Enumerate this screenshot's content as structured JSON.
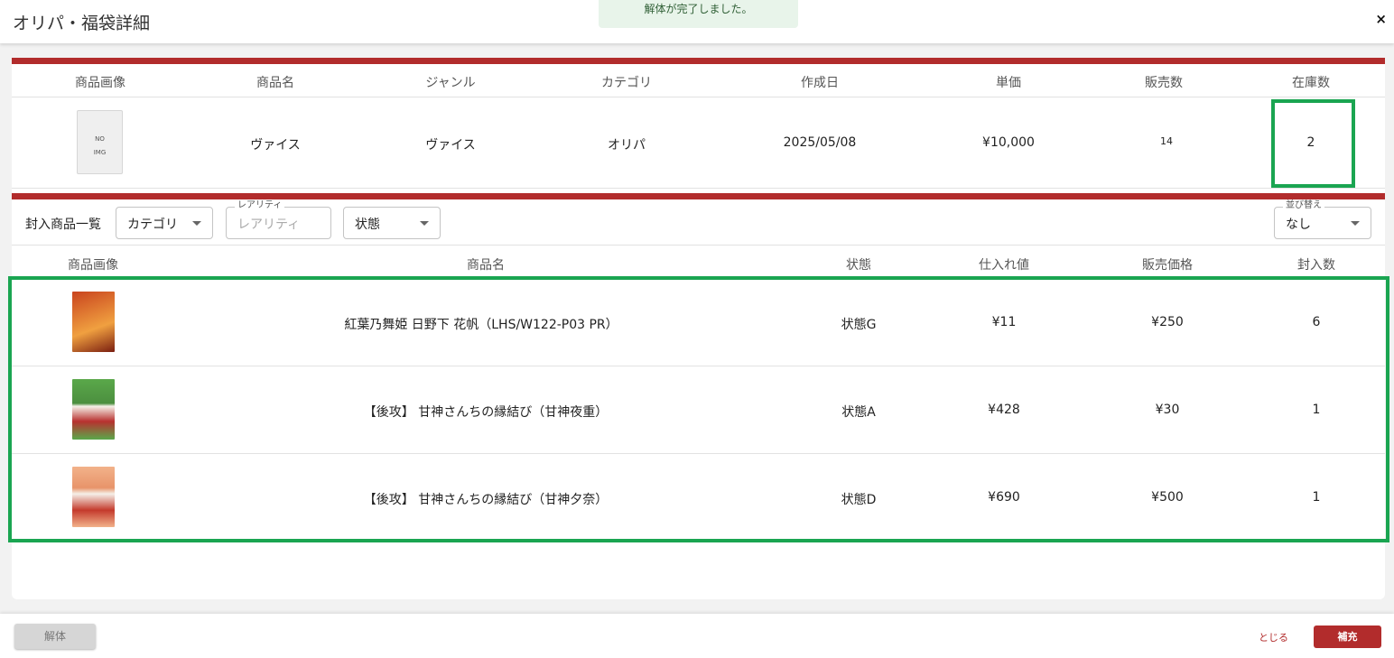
{
  "dialog": {
    "title": "オリパ・福袋詳細",
    "close": "×"
  },
  "toast": "解体が完了しました。",
  "product": {
    "headers": [
      "商品画像",
      "商品名",
      "ジャンル",
      "カテゴリ",
      "作成日",
      "単価",
      "販売数",
      "在庫数"
    ],
    "image_text_line1": "NO",
    "image_text_line2": "IMG",
    "name": "ヴァイス",
    "genre": "ヴァイス",
    "category": "オリパ",
    "created": "2025/05/08",
    "unit_price": "¥10,000",
    "sold": "14",
    "stock": "2"
  },
  "filters": {
    "label": "封入商品一覧",
    "category": "カテゴリ",
    "rarity_label": "レアリティ",
    "rarity_placeholder": "レアリティ",
    "condition": "状態",
    "sort_label": "並び替え",
    "sort_value": "なし"
  },
  "items_table": {
    "headers": [
      "商品画像",
      "商品名",
      "状態",
      "仕入れ値",
      "販売価格",
      "封入数"
    ],
    "rows": [
      {
        "name": "紅葉乃舞姫 日野下 花帆（LHS/W122-P03 PR）",
        "condition": "状態G",
        "cost": "¥11",
        "price": "¥250",
        "count": "6",
        "thumb_colors": [
          "#c9441e",
          "#f0a040"
        ]
      },
      {
        "name": "【後攻】 甘神さんちの縁結び（甘神夜重）",
        "condition": "状態A",
        "cost": "¥428",
        "price": "¥30",
        "count": "1",
        "thumb_colors": [
          "#5aa84a",
          "#b8312f"
        ]
      },
      {
        "name": "【後攻】 甘神さんちの縁結び（甘神夕奈）",
        "condition": "状態D",
        "cost": "¥690",
        "price": "¥500",
        "count": "1",
        "thumb_colors": [
          "#f2b28a",
          "#c43a2c"
        ]
      }
    ]
  },
  "footer": {
    "dismantle": "解体",
    "close": "とじる",
    "supply": "補充"
  }
}
